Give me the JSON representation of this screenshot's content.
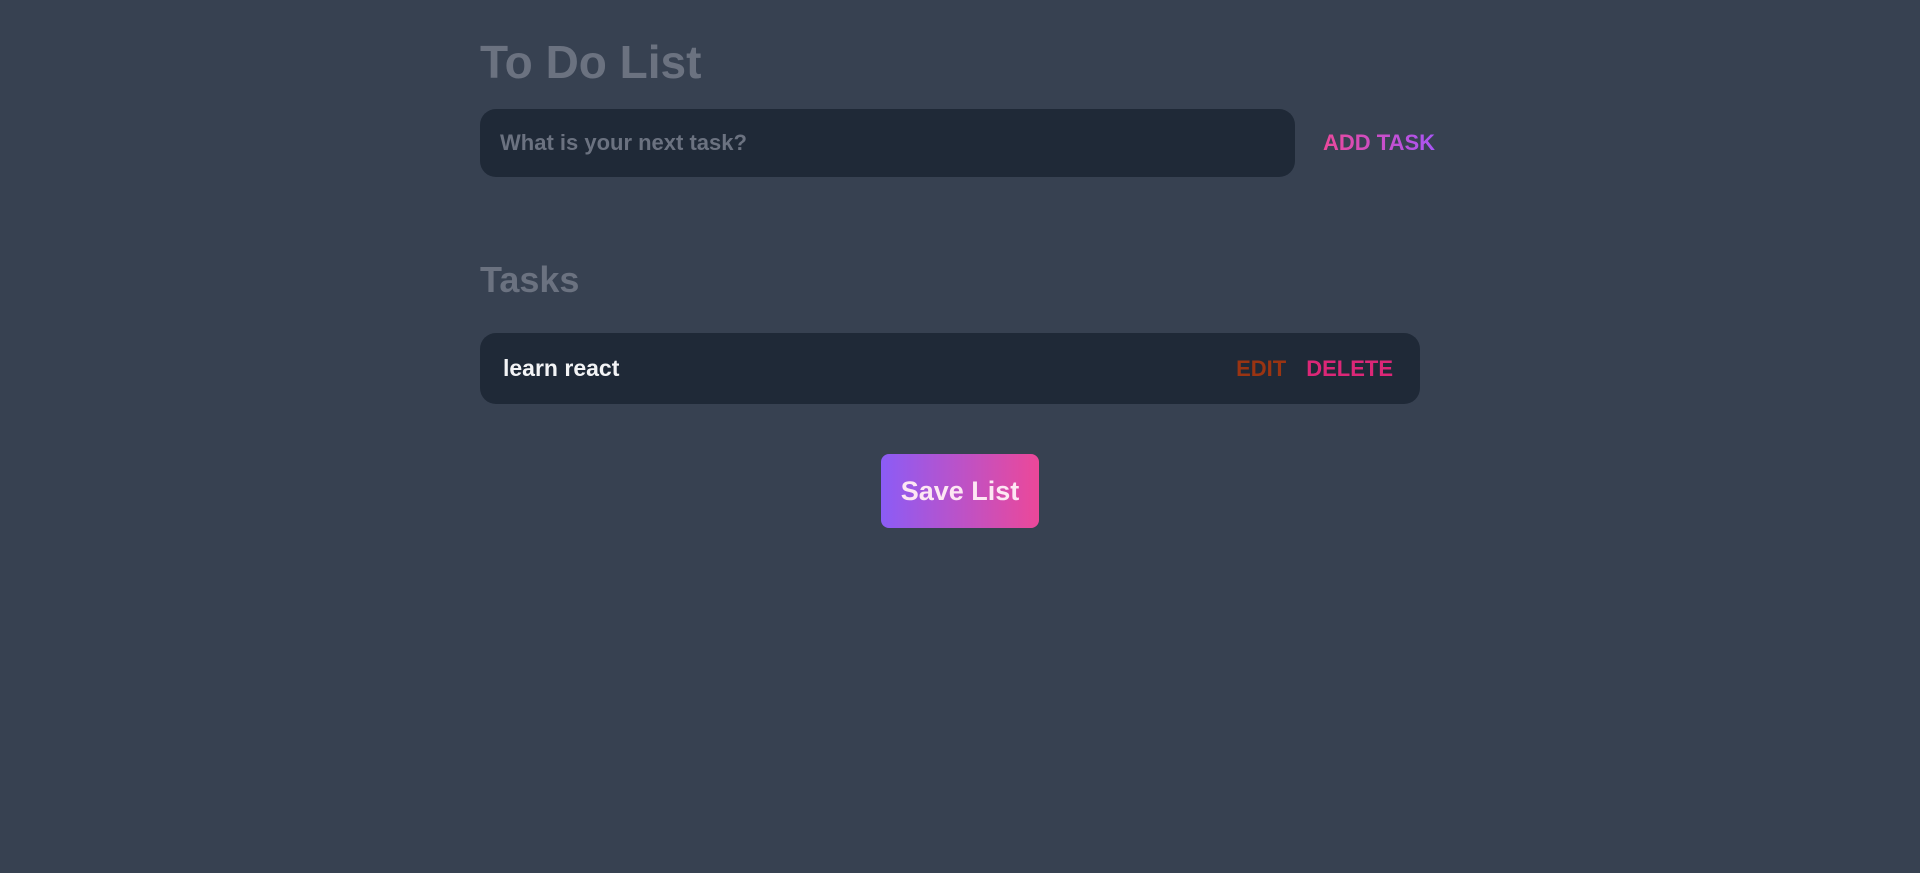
{
  "header": {
    "title": "To Do List"
  },
  "new_task": {
    "placeholder": "What is your next task?",
    "value": "",
    "add_label": "ADD TASK"
  },
  "tasks_section": {
    "title": "Tasks",
    "items": [
      {
        "text": "learn react",
        "edit_label": "EDIT",
        "delete_label": "DELETE"
      }
    ]
  },
  "footer": {
    "save_label": "Save List"
  },
  "colors": {
    "background": "#374151",
    "panel": "#1f2937",
    "muted_text": "#6b7280",
    "edit": "#9a3412",
    "delete": "#db2777",
    "gradient_start": "#8b5cf6",
    "gradient_end": "#ec4899"
  }
}
